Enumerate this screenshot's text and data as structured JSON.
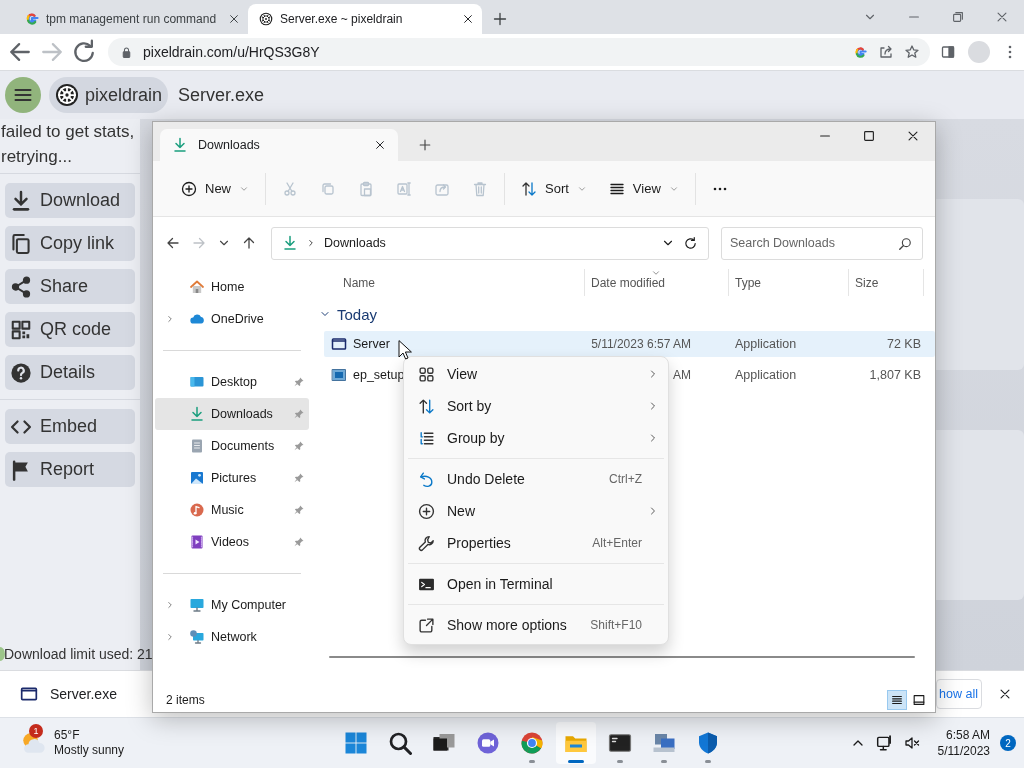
{
  "browser": {
    "tabs": [
      {
        "title": "tpm management run command",
        "selected": false
      },
      {
        "title": "Server.exe ~ pixeldrain",
        "selected": true
      }
    ],
    "forward_disabled": true,
    "url": "pixeldrain.com/u/HrQS3G8Y"
  },
  "page": {
    "brand": "pixeldrain",
    "file_title": "Server.exe",
    "status": "failed to get stats, retrying...",
    "action_groups": [
      [
        {
          "label": "Download"
        },
        {
          "label": "Copy link"
        },
        {
          "label": "Share"
        },
        {
          "label": "QR code"
        },
        {
          "label": "Details"
        }
      ],
      [
        {
          "label": "Embed"
        },
        {
          "label": "Report"
        }
      ]
    ],
    "download_limit": "Download limit used: 21"
  },
  "download_bar": {
    "file": "Server.exe",
    "button": "how all"
  },
  "explorer": {
    "tab": "Downloads",
    "command_groups": [
      [
        {
          "label": "New",
          "dropdown": true,
          "disabled": false
        }
      ],
      [
        {
          "disabled": true
        },
        {
          "disabled": true
        },
        {
          "disabled": true
        },
        {
          "disabled": true
        },
        {
          "disabled": true
        },
        {
          "disabled": true
        }
      ],
      [
        {
          "label": "Sort",
          "dropdown": true,
          "disabled": false
        },
        {
          "label": "View",
          "dropdown": true,
          "disabled": false
        }
      ],
      [
        {
          "disabled": false
        }
      ]
    ],
    "forward_disabled": true,
    "address": "Downloads",
    "search": {
      "placeholder": "Search Downloads"
    },
    "nav_groups": [
      [
        {
          "label": "Home",
          "selected": false
        },
        {
          "label": "OneDrive",
          "expanded": false,
          "selected": false
        }
      ],
      [
        {
          "label": "Desktop",
          "pinned": true,
          "selected": false
        },
        {
          "label": "Downloads",
          "pinned": true,
          "selected": true
        },
        {
          "label": "Documents",
          "pinned": true,
          "selected": false
        },
        {
          "label": "Pictures",
          "pinned": true,
          "selected": false
        },
        {
          "label": "Music",
          "pinned": true,
          "selected": false
        },
        {
          "label": "Videos",
          "pinned": true,
          "selected": false
        }
      ],
      [
        {
          "label": "My Computer",
          "expanded": false,
          "selected": false
        },
        {
          "label": "Network",
          "expanded": false,
          "selected": false
        }
      ]
    ],
    "columns": [
      {
        "label": "Name",
        "sorted": false
      },
      {
        "label": "Date modified",
        "sorted": true
      },
      {
        "label": "Type",
        "sorted": false
      },
      {
        "label": "Size",
        "sorted": false
      }
    ],
    "groups": [
      {
        "label": "Today",
        "expanded": true,
        "rows": [
          {
            "name": "Server",
            "date": "5/11/2023 6:57 AM",
            "type": "Application",
            "size": "72 KB",
            "selected": true
          },
          {
            "name": "ep_setup",
            "date": "AM",
            "type": "Application",
            "size": "1,807 KB",
            "selected": false
          }
        ]
      }
    ],
    "status": "2 items",
    "views": [
      {
        "selected": true
      },
      {
        "selected": false
      }
    ]
  },
  "context_menu": {
    "groups": [
      [
        {
          "label": "View",
          "submenu": true
        },
        {
          "label": "Sort by",
          "submenu": true
        },
        {
          "label": "Group by",
          "submenu": true
        }
      ],
      [
        {
          "label": "Undo Delete",
          "shortcut": "Ctrl+Z",
          "submenu": false
        },
        {
          "label": "New",
          "submenu": true
        },
        {
          "label": "Properties",
          "shortcut": "Alt+Enter",
          "submenu": false
        }
      ],
      [
        {
          "label": "Open in Terminal",
          "submenu": false
        }
      ],
      [
        {
          "label": "Show more options",
          "shortcut": "Shift+F10",
          "submenu": false
        }
      ]
    ]
  },
  "taskbar": {
    "weather": {
      "temperature": "65°F",
      "condition": "Mostly sunny",
      "badge": "1"
    },
    "apps": [
      {
        "running": false,
        "active": false
      },
      {
        "running": false,
        "active": false
      },
      {
        "running": false,
        "active": false
      },
      {
        "running": false,
        "active": false
      },
      {
        "running": true,
        "active": false
      },
      {
        "running": true,
        "active": true
      },
      {
        "running": true,
        "active": false
      },
      {
        "running": true,
        "active": false
      },
      {
        "running": true,
        "active": false
      }
    ],
    "time": "6:58 AM",
    "date": "5/11/2023",
    "notifications": "2"
  }
}
